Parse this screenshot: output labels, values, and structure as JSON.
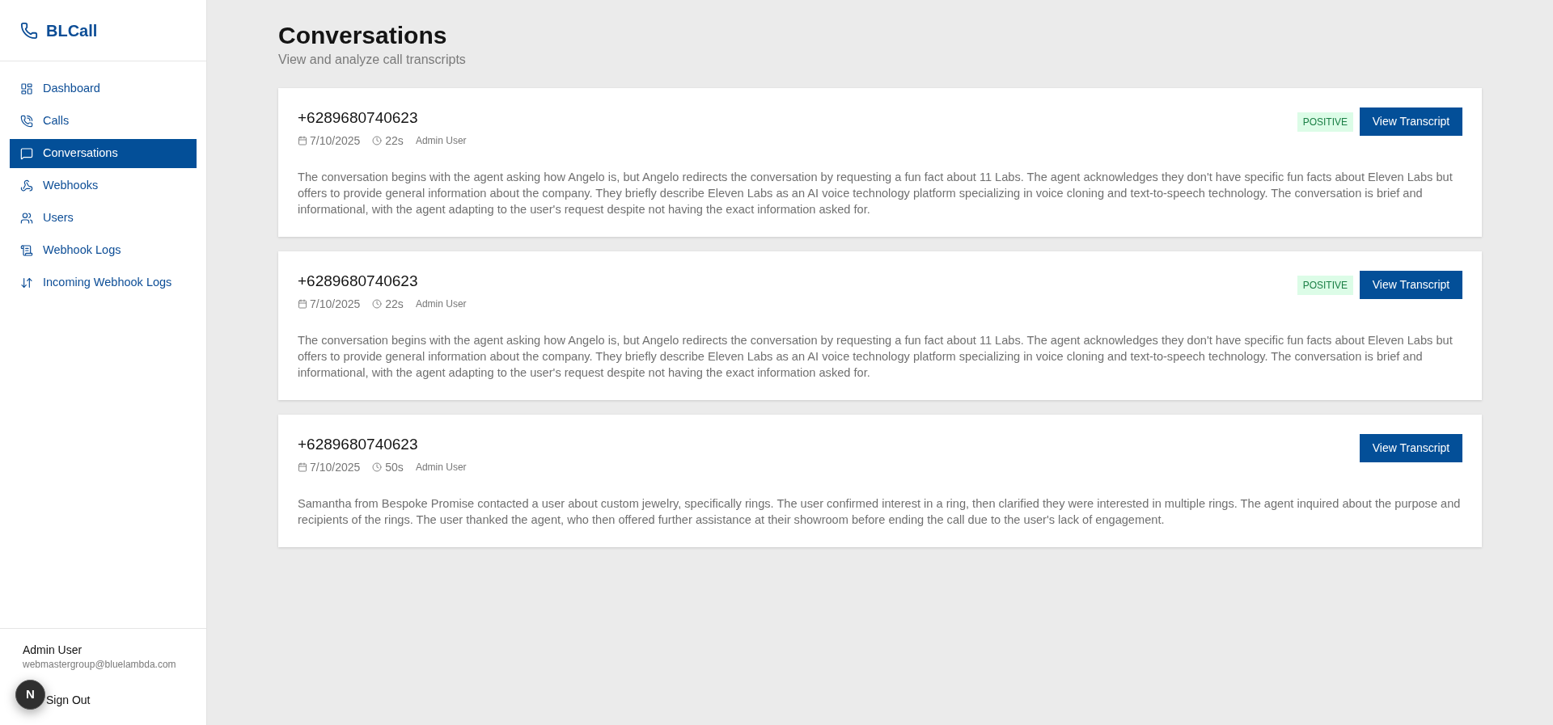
{
  "sidebar": {
    "brand": "BLCall",
    "nav_items": [
      {
        "label": "Dashboard",
        "selected": false
      },
      {
        "label": "Calls",
        "selected": false
      },
      {
        "label": "Conversations",
        "selected": true
      },
      {
        "label": "Webhooks",
        "selected": false
      },
      {
        "label": "Users",
        "selected": false
      },
      {
        "label": "Webhook Logs",
        "selected": false
      },
      {
        "label": "Incoming Webhook Logs",
        "selected": false
      }
    ],
    "user": {
      "name": "Admin User",
      "email": "webmastergroup@bluelambda.com"
    },
    "sign_out": "Sign Out"
  },
  "page": {
    "title": "Conversations",
    "subtitle": "View and analyze call transcripts"
  },
  "conversations": [
    {
      "phone": "+6289680740623",
      "date": "7/10/2025",
      "duration": "22s",
      "agent": "Admin User",
      "sentiment": "POSITIVE",
      "button": "View Transcript",
      "summary": "The conversation begins with the agent asking how Angelo is, but Angelo redirects the conversation by requesting a fun fact about 11 Labs. The agent acknowledges they don't have specific fun facts about Eleven Labs but offers to provide general information about the company. They briefly describe Eleven Labs as an AI voice technology platform specializing in voice cloning and text-to-speech technology. The conversation is brief and informational, with the agent adapting to the user's request despite not having the exact information asked for."
    },
    {
      "phone": "+6289680740623",
      "date": "7/10/2025",
      "duration": "22s",
      "agent": "Admin User",
      "sentiment": "POSITIVE",
      "button": "View Transcript",
      "summary": "The conversation begins with the agent asking how Angelo is, but Angelo redirects the conversation by requesting a fun fact about 11 Labs. The agent acknowledges they don't have specific fun facts about Eleven Labs but offers to provide general information about the company. They briefly describe Eleven Labs as an AI voice technology platform specializing in voice cloning and text-to-speech technology. The conversation is brief and informational, with the agent adapting to the user's request despite not having the exact information asked for."
    },
    {
      "phone": "+6289680740623",
      "date": "7/10/2025",
      "duration": "50s",
      "agent": "Admin User",
      "button": "View Transcript",
      "summary": "Samantha from Bespoke Promise contacted a user about custom jewelry, specifically rings. The user confirmed interest in a ring, then clarified they were interested in multiple rings. The agent inquired about the purpose and recipients of the rings. The user thanked the agent, who then offered further assistance at their showroom before ending the call due to the user's lack of engagement."
    }
  ],
  "dev_indicator": {
    "label": "N"
  }
}
